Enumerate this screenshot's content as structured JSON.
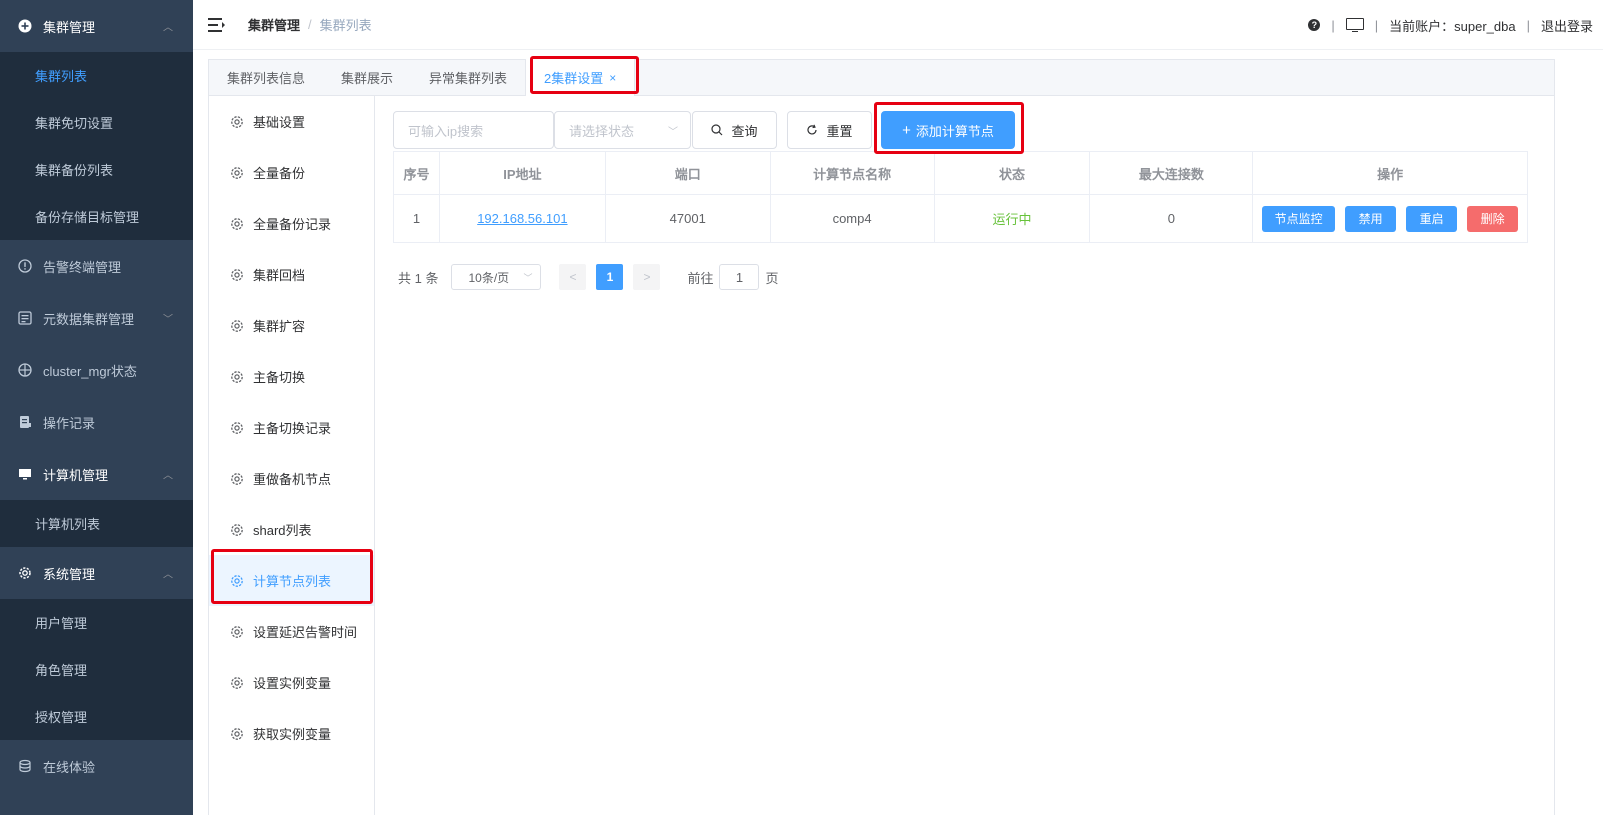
{
  "sidebar": {
    "groups": [
      {
        "label": "集群管理",
        "icon": "plus-circle-icon",
        "expanded": true,
        "children": [
          "集群列表",
          "集群免切设置",
          "集群备份列表",
          "备份存储目标管理"
        ],
        "active_child": 0
      },
      {
        "label": "告警终端管理",
        "icon": "alert-circle-icon"
      },
      {
        "label": "元数据集群管理",
        "icon": "metadata-icon",
        "collapsed": true
      },
      {
        "label": "cluster_mgr状态",
        "icon": "crosshair-icon"
      },
      {
        "label": "操作记录",
        "icon": "document-icon"
      },
      {
        "label": "计算机管理",
        "icon": "computer-icon",
        "expanded": true,
        "children": [
          "计算机列表"
        ]
      },
      {
        "label": "系统管理",
        "icon": "gear-icon",
        "expanded": true,
        "children": [
          "用户管理",
          "角色管理",
          "授权管理"
        ]
      },
      {
        "label": "在线体验",
        "icon": "database-icon"
      }
    ]
  },
  "header": {
    "breadcrumb": [
      "集群管理",
      "集群列表"
    ],
    "account_label": "当前账户：super_dba",
    "logout": "退出登录",
    "separator": "|"
  },
  "tabs": [
    {
      "label": "集群列表信息"
    },
    {
      "label": "集群展示"
    },
    {
      "label": "异常集群列表"
    },
    {
      "label": "2集群设置",
      "active": true,
      "close": "×"
    }
  ],
  "inner_menu": [
    "基础设置",
    "全量备份",
    "全量备份记录",
    "集群回档",
    "集群扩容",
    "主备切换",
    "主备切换记录",
    "重做备机节点",
    "shard列表",
    "计算节点列表",
    "设置延迟告警时间",
    "设置实例变量",
    "获取实例变量"
  ],
  "inner_menu_active": 9,
  "toolbar": {
    "ip_placeholder": "可输入ip搜索",
    "status_placeholder": "请选择状态",
    "query": "查询",
    "reset": "重置",
    "add": "添加计算节点"
  },
  "table": {
    "columns": [
      "序号",
      "IP地址",
      "端口",
      "计算节点名称",
      "状态",
      "最大连接数",
      "操作"
    ],
    "rows": [
      {
        "index": "1",
        "ip": "192.168.56.101",
        "port": "47001",
        "name": "comp4",
        "status": "运行中",
        "max_conn": "0"
      }
    ],
    "actions": [
      "节点监控",
      "禁用",
      "重启",
      "删除"
    ]
  },
  "pagination": {
    "total": "共 1 条",
    "page_size": "10条/页",
    "current": "1",
    "goto_prefix": "前往",
    "goto_value": "1",
    "goto_suffix": "页"
  },
  "colors": {
    "sidebar_bg": "#304156",
    "primary": "#409eff",
    "danger": "#f56c6c",
    "success": "#67c23a",
    "highlight": "#e60012"
  }
}
